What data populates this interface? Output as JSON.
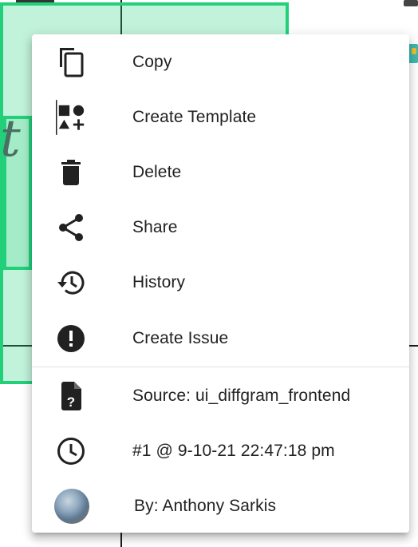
{
  "menu": {
    "items": [
      {
        "label": "Copy",
        "icon": "copy-icon"
      },
      {
        "label": "Create Template",
        "icon": "create-template-icon"
      },
      {
        "label": "Delete",
        "icon": "trash-icon"
      },
      {
        "label": "Share",
        "icon": "share-icon"
      },
      {
        "label": "History",
        "icon": "history-icon"
      },
      {
        "label": "Create Issue",
        "icon": "alert-circle-icon"
      }
    ],
    "info": [
      {
        "label": "Source: ui_diffgram_frontend",
        "icon": "file-question-icon"
      },
      {
        "label": "#1 @ 9-10-21 22:47:18 pm",
        "icon": "clock-icon"
      },
      {
        "label": "By: Anthony Sarkis",
        "icon": "avatar"
      }
    ]
  },
  "canvas": {
    "text": "t"
  },
  "colors": {
    "annotation_box": "#22d07a",
    "icon": "#212121",
    "text": "#212121"
  }
}
